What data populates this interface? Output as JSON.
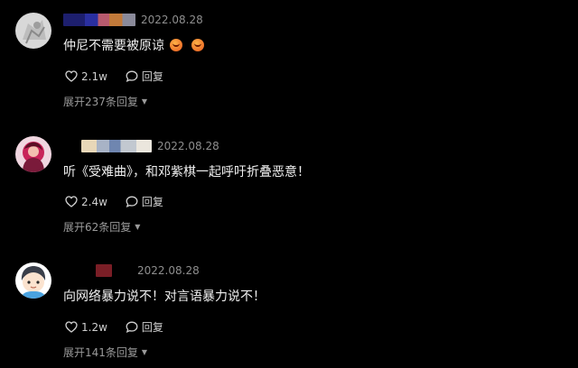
{
  "comments": [
    {
      "date": "2022.08.28",
      "text": "仲尼不需要被原谅",
      "emojis": [
        "fire-face-emoji",
        "fire-face-emoji"
      ],
      "likes": "2.1w",
      "reply_label": "回复",
      "expand_label": "展开237条回复",
      "avatar": "sketch-avatar"
    },
    {
      "date": "2022.08.28",
      "text": "听《受难曲》，和邓紫棋一起呼吁折叠恶意！",
      "likes": "2.4w",
      "reply_label": "回复",
      "expand_label": "展开62条回复",
      "avatar": "red-character-avatar"
    },
    {
      "date": "2022.08.28",
      "text": "向网络暴力说不！对言语暴力说不！",
      "likes": "1.2w",
      "reply_label": "回复",
      "expand_label": "展开141条回复",
      "avatar": "cartoon-boy-avatar"
    }
  ],
  "colors": {
    "background": "#000000",
    "text": "#f0f0f0",
    "muted": "#8e8e8e"
  }
}
